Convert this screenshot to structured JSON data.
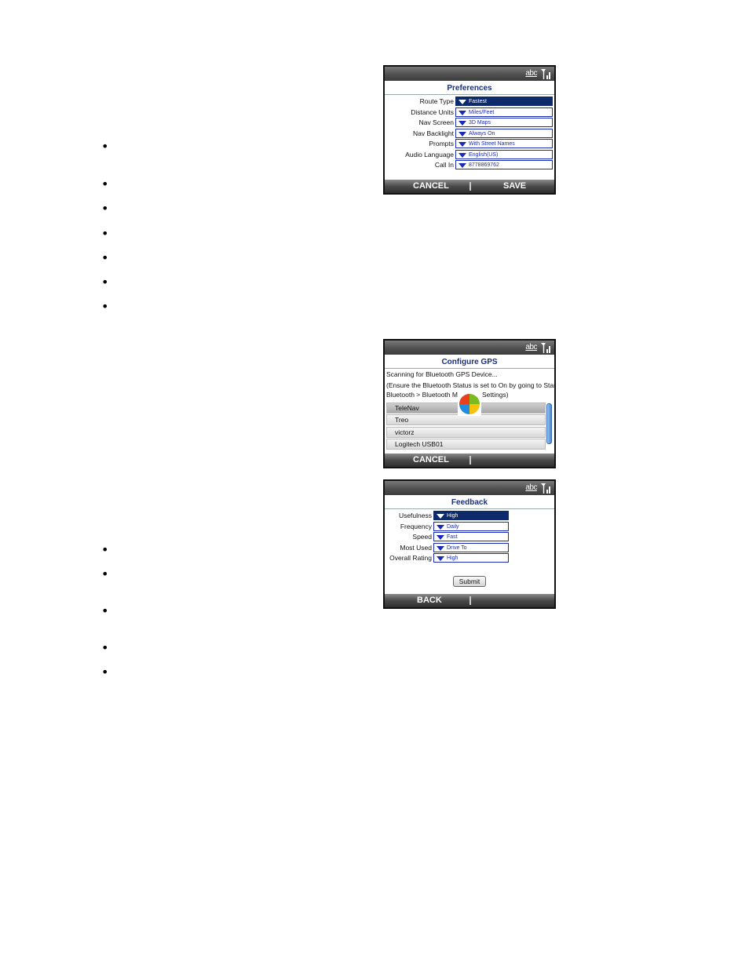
{
  "status": {
    "input_mode": "abc"
  },
  "preferences": {
    "title": "Preferences",
    "fields": [
      {
        "label": "Route Type",
        "value": "Fastest"
      },
      {
        "label": "Distance Units",
        "value": "Miles/Feet"
      },
      {
        "label": "Nav Screen",
        "value": "3D Maps"
      },
      {
        "label": "Nav Backlight",
        "value": "Always On"
      },
      {
        "label": "Prompts",
        "value": "With Street Names"
      },
      {
        "label": "Audio Language",
        "value": "English(US)"
      },
      {
        "label": "Call In",
        "value": "8778869762"
      }
    ],
    "left_soft": "CANCEL",
    "right_soft": "SAVE"
  },
  "gps": {
    "title": "Configure GPS",
    "line1": "Scanning for Bluetooth GPS Device...",
    "line2": "(Ensure the Bluetooth Status is set to On by going to Start >",
    "line3": "Bluetooth > Bluetooth Ma",
    "line3b": "Settings)",
    "devices": [
      "TeleNav",
      "Treo",
      "victorz",
      "Logitech USB01"
    ],
    "left_soft": "CANCEL"
  },
  "feedback": {
    "title": "Feedback",
    "fields": [
      {
        "label": "Usefulness",
        "value": "High"
      },
      {
        "label": "Frequency",
        "value": "Daily"
      },
      {
        "label": "Speed",
        "value": "Fast"
      },
      {
        "label": "Most Used",
        "value": "Drive To"
      },
      {
        "label": "Overall Rating",
        "value": "High"
      }
    ],
    "submit": "Submit",
    "left_soft": "BACK"
  }
}
